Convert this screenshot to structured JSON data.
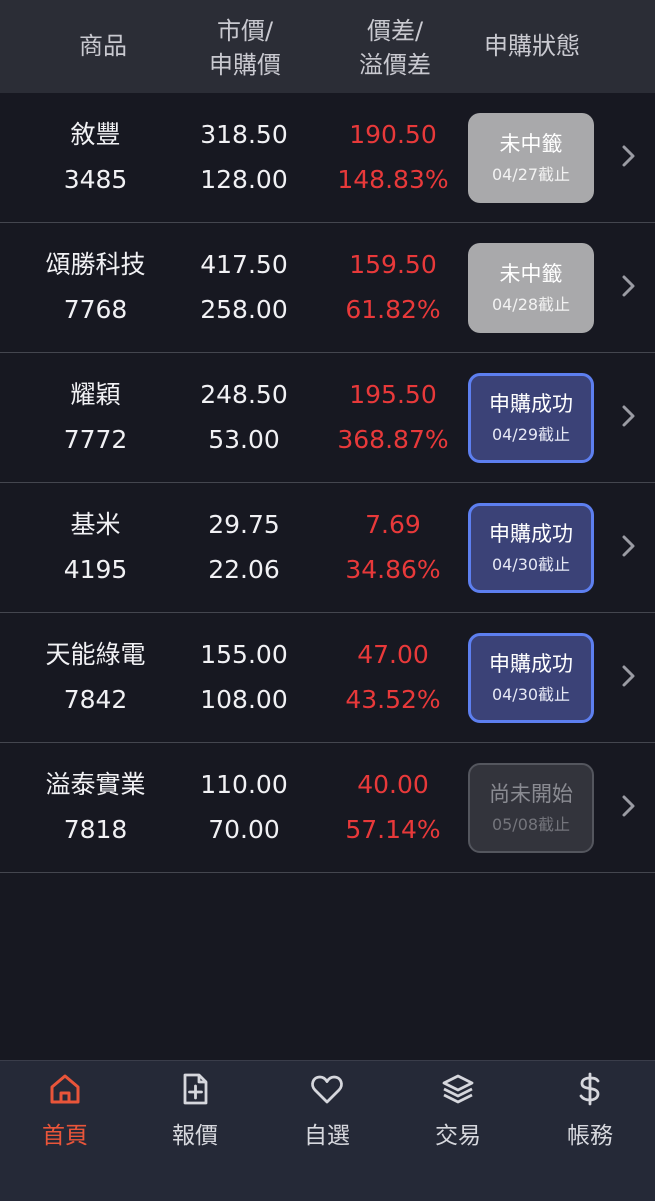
{
  "header": {
    "col_product": "商品",
    "col_price_line1": "市價/",
    "col_price_line2": "申購價",
    "col_diff_line1": "價差/",
    "col_diff_line2": "溢價差",
    "col_status": "申購狀態"
  },
  "rows": [
    {
      "name": "敘豐",
      "code": "3485",
      "market": "318.50",
      "subscription": "128.00",
      "diff": "190.50",
      "premium": "148.83%",
      "status": "未中籤",
      "deadline": "04/27截止",
      "state": "lost"
    },
    {
      "name": "頌勝科技",
      "code": "7768",
      "market": "417.50",
      "subscription": "258.00",
      "diff": "159.50",
      "premium": "61.82%",
      "status": "未中籤",
      "deadline": "04/28截止",
      "state": "lost"
    },
    {
      "name": "耀穎",
      "code": "7772",
      "market": "248.50",
      "subscription": "53.00",
      "diff": "195.50",
      "premium": "368.87%",
      "status": "申購成功",
      "deadline": "04/29截止",
      "state": "ok"
    },
    {
      "name": "基米",
      "code": "4195",
      "market": "29.75",
      "subscription": "22.06",
      "diff": "7.69",
      "premium": "34.86%",
      "status": "申購成功",
      "deadline": "04/30截止",
      "state": "ok"
    },
    {
      "name": "天能綠電",
      "code": "7842",
      "market": "155.00",
      "subscription": "108.00",
      "diff": "47.00",
      "premium": "43.52%",
      "status": "申購成功",
      "deadline": "04/30截止",
      "state": "ok"
    },
    {
      "name": "溢泰實業",
      "code": "7818",
      "market": "110.00",
      "subscription": "70.00",
      "diff": "40.00",
      "premium": "57.14%",
      "status": "尚未開始",
      "deadline": "05/08截止",
      "state": "pending"
    }
  ],
  "tabs": [
    {
      "label": "首頁",
      "icon": "home-icon",
      "active": true
    },
    {
      "label": "報價",
      "icon": "document-plus-icon",
      "active": false
    },
    {
      "label": "自選",
      "icon": "heart-icon",
      "active": false
    },
    {
      "label": "交易",
      "icon": "layers-icon",
      "active": false
    },
    {
      "label": "帳務",
      "icon": "dollar-icon",
      "active": false
    }
  ],
  "colors": {
    "background": "#171821",
    "header_bg": "#2b2d36",
    "negative_red": "#e8393a",
    "accent_active": "#e9553a",
    "success_border": "#5d7ff0",
    "success_bg": "#3b4277",
    "lost_bg": "#a9a9ab"
  }
}
